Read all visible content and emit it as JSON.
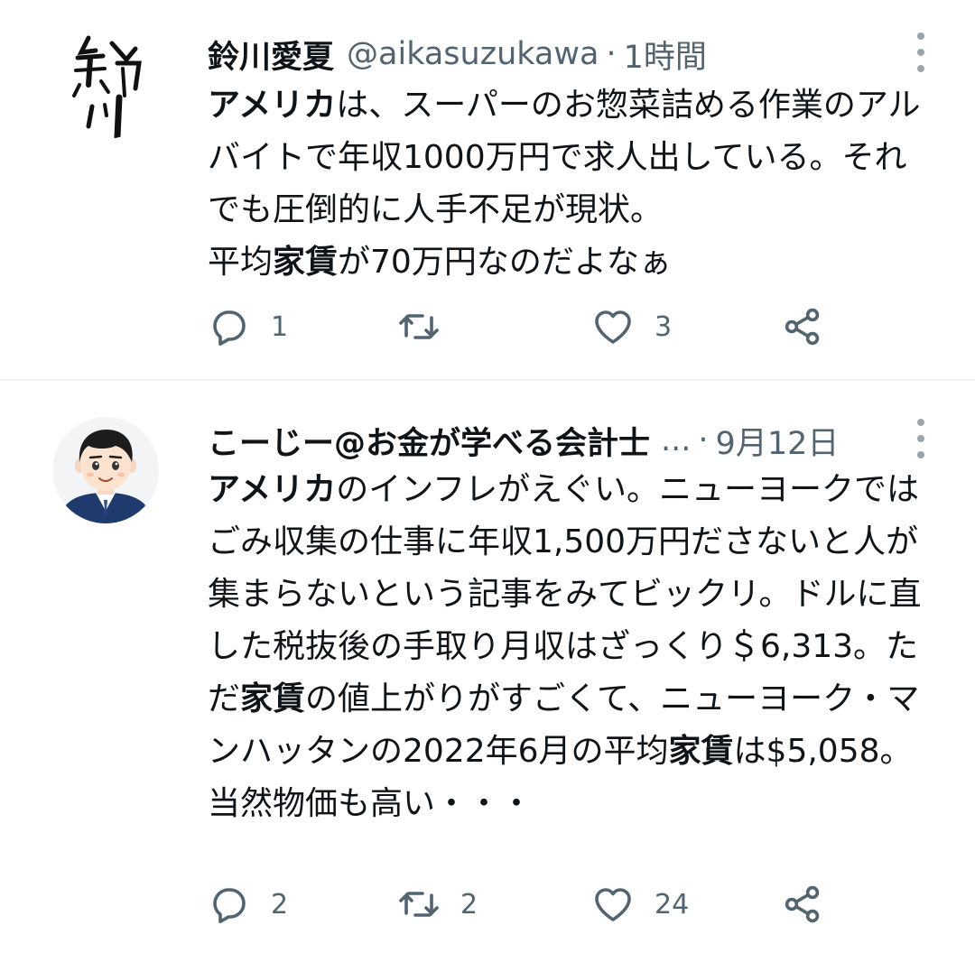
{
  "tweets": [
    {
      "name": "鈴川愛夏",
      "handle": "@aikasuzukawa",
      "separator": "·",
      "time": "1時間",
      "avatar_icon": "calligraphy-avatar",
      "body": {
        "p1_bold": "アメリカ",
        "p1_rest": "は、スーパーのお惣菜詰める作業のアルバイトで年収1000万円で求人出している。それでも圧倒的に人手不足が現状。\n平均",
        "p2_bold": "家賃",
        "p2_rest": "が70万円なのだよなぁ"
      },
      "stats": {
        "replies": "1",
        "retweets": "",
        "likes": "3"
      }
    },
    {
      "name": "こーじー@お金が学べる会計士",
      "ellipsis": "...",
      "separator": "·",
      "time": "9月12日",
      "avatar_icon": "cartoon-man-avatar",
      "body": {
        "p1_bold": "アメリカ",
        "p1_rest": "のインフレがえぐい。ニューヨークではごみ収集の仕事に年収1,500万円ださないと人が集まらないという記事をみてビックリ。ドルに直した税抜後の手取り月収はざっくり＄6,313。ただ",
        "p2_bold": "家賃",
        "p2_rest": "の値上がりがすごくて、ニューヨーク・マンハッタンの2022年6月の平均",
        "p3_bold": "家賃",
        "p3_rest": "は$5,058。当然物価も高い・・・"
      },
      "stats": {
        "replies": "2",
        "retweets": "2",
        "likes": "24"
      }
    }
  ],
  "icons": {
    "reply": "reply-icon",
    "retweet": "retweet-icon",
    "like": "heart-icon",
    "share": "share-icon",
    "more": "more-options-icon"
  },
  "colors": {
    "text": "#0f1419",
    "secondary": "#536471",
    "divider": "#eff3f4",
    "suit": "#1f3a6d"
  }
}
